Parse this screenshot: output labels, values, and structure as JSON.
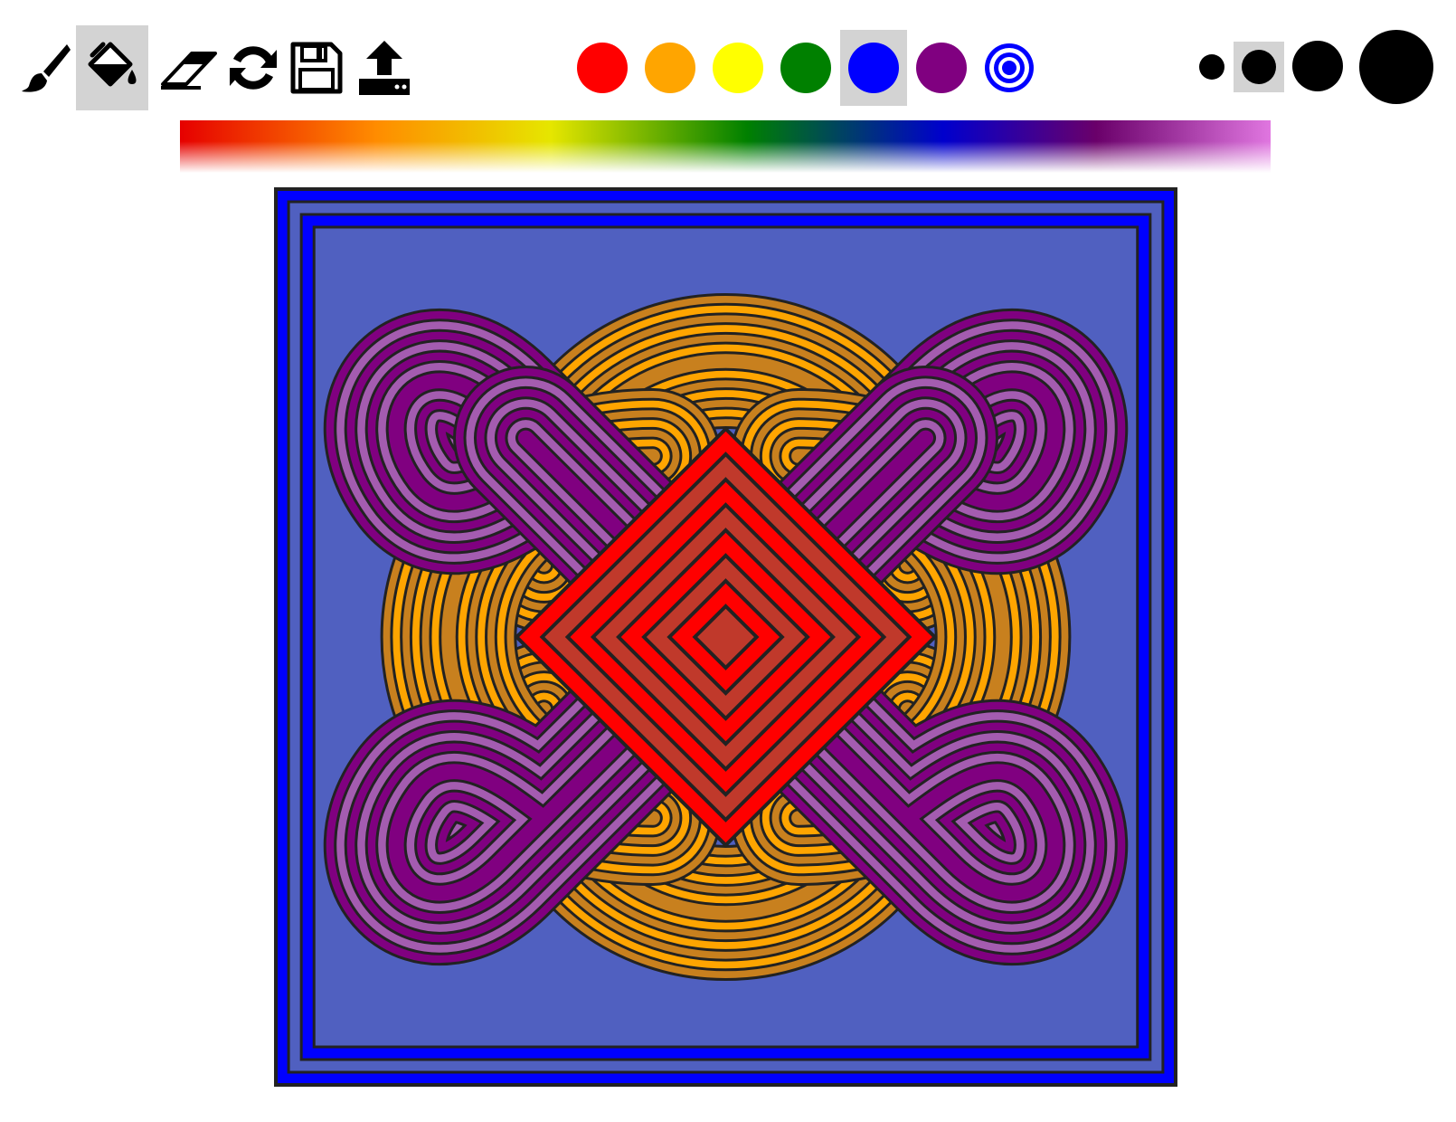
{
  "toolbar": {
    "tools": [
      {
        "name": "brush-icon",
        "active": false
      },
      {
        "name": "paint-bucket-icon",
        "active": true
      },
      {
        "name": "eraser-icon",
        "active": false
      },
      {
        "name": "refresh-icon",
        "active": false
      },
      {
        "name": "save-icon",
        "active": false
      },
      {
        "name": "upload-icon",
        "active": false
      }
    ]
  },
  "palette": {
    "swatches": [
      "#ff0000",
      "#ffa500",
      "#ffff00",
      "#008000",
      "#0000ff",
      "#800080"
    ],
    "selected": "#0000ff",
    "extra": "target-icon"
  },
  "brush_sizes": {
    "options": [
      "small",
      "medium",
      "large",
      "x-large"
    ],
    "selected": "medium"
  },
  "coloring_colors": {
    "background": "#0000ff",
    "border_alt": "#5060c0",
    "purple_dark": "#800080",
    "purple_light": "#a45cb0",
    "orange_dark": "#c8801e",
    "orange_light": "#ffa500",
    "red_bright": "#ff0000",
    "red_dark": "#c0392b",
    "outline": "#222222"
  }
}
